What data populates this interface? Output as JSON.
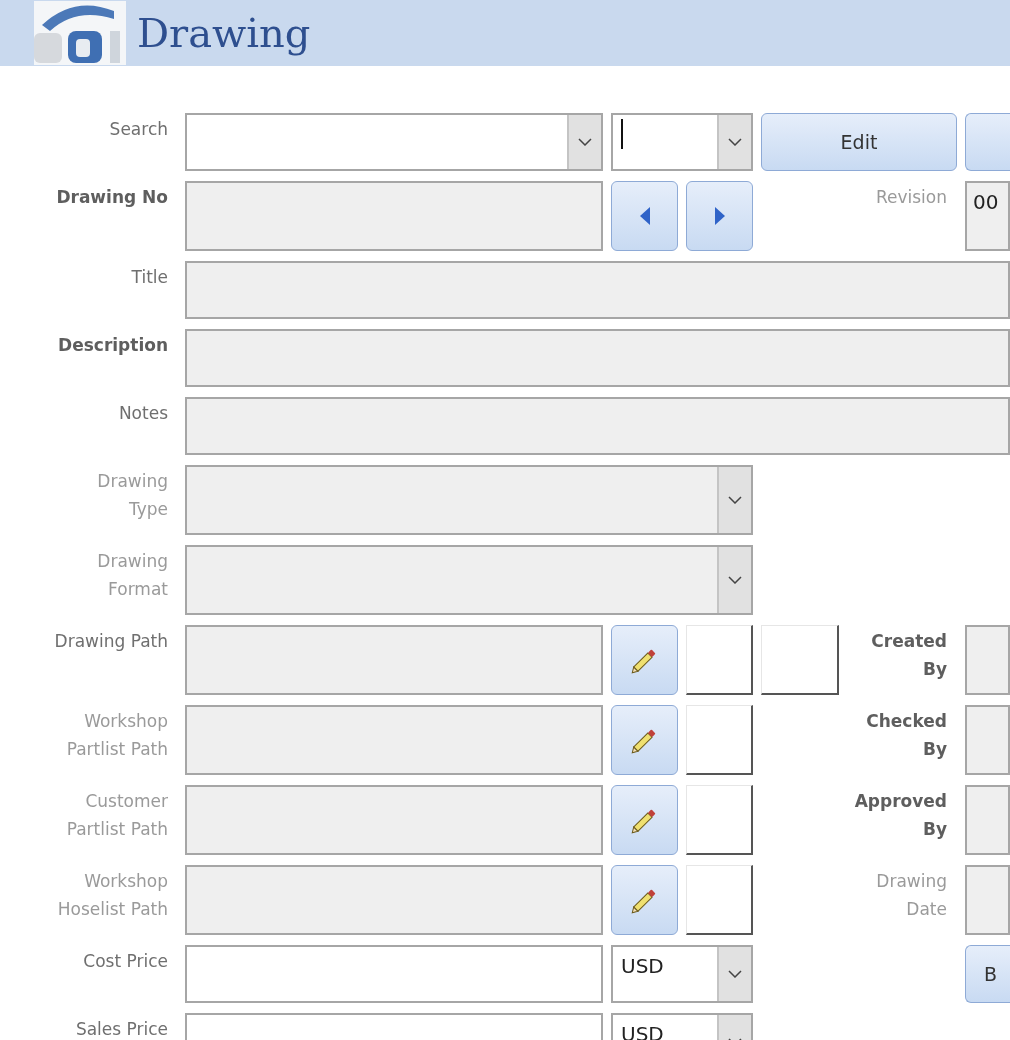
{
  "header": {
    "title": "Drawing"
  },
  "rows": [
    {
      "label": "Search",
      "bold": false,
      "greyed": false,
      "field": {
        "kind": "combo",
        "locked": false
      },
      "extras": [
        {
          "kind": "combo",
          "locked": false,
          "focused": true
        },
        {
          "kind": "button",
          "label": "Edit"
        }
      ],
      "side": {
        "kind": "button"
      }
    },
    {
      "label": "Drawing No",
      "bold": true,
      "greyed": false,
      "field": {
        "kind": "text",
        "locked": true
      },
      "extras": [
        {
          "kind": "prev"
        },
        {
          "kind": "next"
        }
      ],
      "side": {
        "kind": "field",
        "label": "Revision",
        "bold": false,
        "greyed": true,
        "value": "00",
        "locked": true
      }
    },
    {
      "label": "Title",
      "bold": false,
      "greyed": false,
      "field": {
        "kind": "text",
        "locked": true
      }
    },
    {
      "label": "Description",
      "bold": true,
      "greyed": false,
      "field": {
        "kind": "text",
        "locked": true
      }
    },
    {
      "label": "Notes",
      "bold": false,
      "greyed": false,
      "field": {
        "kind": "text",
        "locked": true
      }
    },
    {
      "label": "Drawing\nType",
      "bold": false,
      "greyed": true,
      "field": {
        "kind": "combo",
        "locked": true
      }
    },
    {
      "label": "Drawing\nFormat",
      "bold": false,
      "greyed": true,
      "field": {
        "kind": "combo",
        "locked": true
      }
    },
    {
      "label": "Drawing Path",
      "bold": false,
      "greyed": false,
      "field": {
        "kind": "text",
        "locked": true
      },
      "extras": [
        {
          "kind": "pencil"
        },
        {
          "kind": "attachment"
        },
        {
          "kind": "attachment"
        }
      ],
      "side": {
        "kind": "field",
        "label": "Created\nBy",
        "bold": true,
        "greyed": false,
        "locked": true
      }
    },
    {
      "label": "Workshop\nPartlist Path",
      "bold": false,
      "greyed": true,
      "field": {
        "kind": "text",
        "locked": true
      },
      "extras": [
        {
          "kind": "pencil"
        },
        {
          "kind": "attachment"
        }
      ],
      "side": {
        "kind": "field",
        "label": "Checked\nBy",
        "bold": true,
        "greyed": false,
        "locked": true
      }
    },
    {
      "label": "Customer\nPartlist Path",
      "bold": false,
      "greyed": true,
      "field": {
        "kind": "text",
        "locked": true
      },
      "extras": [
        {
          "kind": "pencil"
        },
        {
          "kind": "attachment"
        }
      ],
      "side": {
        "kind": "field",
        "label": "Approved\nBy",
        "bold": true,
        "greyed": false,
        "locked": true
      }
    },
    {
      "label": "Workshop\nHoselist Path",
      "bold": false,
      "greyed": true,
      "field": {
        "kind": "text",
        "locked": true
      },
      "extras": [
        {
          "kind": "pencil"
        },
        {
          "kind": "attachment"
        }
      ],
      "side": {
        "kind": "field",
        "label": "Drawing\nDate",
        "bold": false,
        "greyed": true,
        "locked": true
      }
    },
    {
      "label": "Cost Price",
      "bold": false,
      "greyed": false,
      "field": {
        "kind": "text",
        "locked": false
      },
      "extras": [
        {
          "kind": "combo",
          "locked": false,
          "value": "USD"
        }
      ],
      "side": {
        "kind": "button",
        "label": "B"
      }
    },
    {
      "label": "Sales Price",
      "bold": false,
      "greyed": false,
      "field": {
        "kind": "text",
        "locked": false
      },
      "extras": [
        {
          "kind": "combo",
          "locked": false,
          "value": "USD"
        }
      ]
    }
  ]
}
